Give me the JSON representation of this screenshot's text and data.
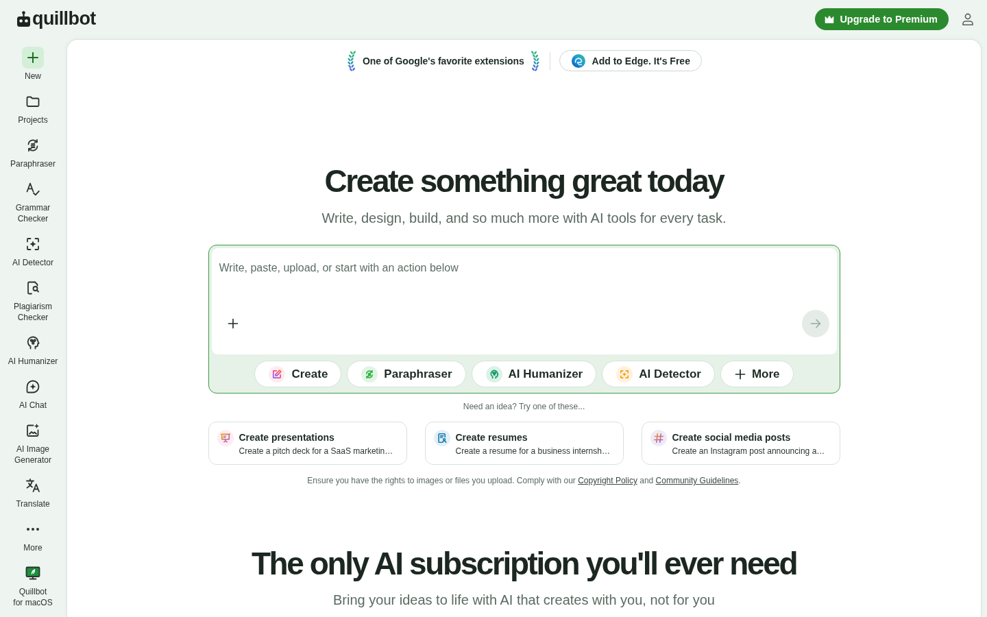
{
  "header": {
    "logo_text": "quillbot",
    "upgrade_button": "Upgrade to Premium"
  },
  "sidebar": {
    "items": [
      {
        "kind": "new",
        "label": "New"
      },
      {
        "kind": "projects",
        "label": "Projects"
      },
      {
        "kind": "paraphraser",
        "label": "Paraphraser"
      },
      {
        "kind": "grammar",
        "label": "Grammar Checker"
      },
      {
        "kind": "detector",
        "label": "AI Detector"
      },
      {
        "kind": "plagiarism",
        "label": "Plagiarism Checker"
      },
      {
        "kind": "humanizer",
        "label": "AI Humanizer"
      },
      {
        "kind": "chat",
        "label": "AI Chat"
      },
      {
        "kind": "image",
        "label": "AI Image Generator"
      },
      {
        "kind": "translate",
        "label": "Translate"
      },
      {
        "kind": "more",
        "label": "More"
      },
      {
        "kind": "desktop",
        "label": "Quillbot for macOS"
      }
    ]
  },
  "banner": {
    "award": "One of Google's favorite extensions",
    "button": "Add to Edge. It's Free"
  },
  "hero": {
    "title": "Create something great today",
    "subtitle": "Write, design, build, and so much more with AI tools for every task."
  },
  "composer": {
    "placeholder": "Write, paste, upload, or start with an action below",
    "actions": [
      {
        "kind": "create",
        "label": "Create"
      },
      {
        "kind": "paraphraser",
        "label": "Paraphraser"
      },
      {
        "kind": "humanizer",
        "label": "AI Humanizer"
      },
      {
        "kind": "detector",
        "label": "AI Detector"
      },
      {
        "kind": "more",
        "label": "More"
      }
    ]
  },
  "ideas": {
    "prompt": "Need an idea? Try one of these...",
    "cards": [
      {
        "kind": "presentation",
        "title": "Create presentations",
        "description": "Create a pitch deck for a SaaS marketin…"
      },
      {
        "kind": "resume",
        "title": "Create resumes",
        "description": "Create a resume for a business internsh…"
      },
      {
        "kind": "social",
        "title": "Create social media posts",
        "description": "Create an Instagram post announcing a…"
      }
    ]
  },
  "notice": {
    "parts": [
      {
        "kind": "text",
        "text": "Ensure you have the rights to images or files you upload. Comply with our "
      },
      {
        "kind": "link",
        "text": "Copyright Policy"
      },
      {
        "kind": "text",
        "text": " and "
      },
      {
        "kind": "link",
        "text": "Community Guidelines"
      },
      {
        "kind": "text",
        "text": "."
      }
    ]
  },
  "subscription": {
    "title": "The only AI subscription you'll ever need",
    "subtitle": "Bring your ideas to life with AI that creates with you, not for you"
  }
}
